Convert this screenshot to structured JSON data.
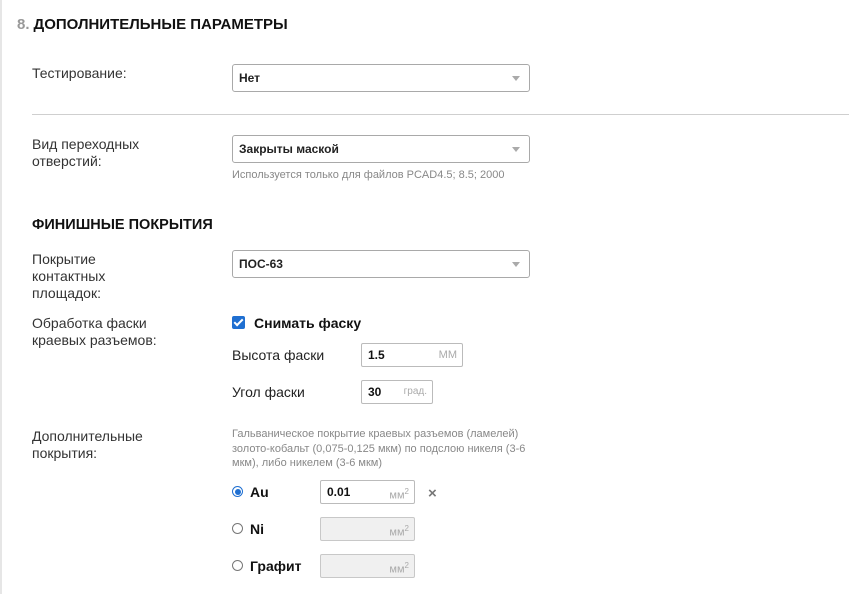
{
  "section": {
    "number": "8.",
    "title": "ДОПОЛНИТЕЛЬНЫЕ ПАРАМЕТРЫ"
  },
  "testing": {
    "label": "Тестирование:",
    "value": "Нет"
  },
  "vias": {
    "label_line1": "Вид переходных",
    "label_line2": "отверстий:",
    "value": "Закрыты маской",
    "hint": "Используется только для файлов PCAD4.5; 8.5; 2000"
  },
  "finish": {
    "title": "ФИНИШНЫЕ ПОКРЫТИЯ",
    "pads": {
      "label_line1": "Покрытие",
      "label_line2": "контактных",
      "label_line3": "площадок:",
      "value": "ПОС-63"
    },
    "bevel": {
      "label_line1": "Обработка фаски",
      "label_line2": "краевых разъемов:",
      "checkbox_label": "Снимать фаску",
      "checked": true,
      "height_label": "Высота фаски",
      "height_value": "1.5",
      "height_unit": "ММ",
      "angle_label": "Угол фаски",
      "angle_value": "30",
      "angle_unit": "град."
    },
    "extra": {
      "label_line1": "Дополнительные",
      "label_line2": "покрытия:",
      "hint_line1": "Гальваническое покрытие краевых разъемов (ламелей)",
      "hint_line2": "золото-кобальт (0,075-0,125 мкм) по подслою никеля (3-6",
      "hint_line3": "мкм), либо никелем (3-6 мкм)",
      "options": [
        {
          "label": "Au",
          "value": "0.01",
          "unit": "мм",
          "unit_sup": "2",
          "selected": true
        },
        {
          "label": "Ni",
          "value": "",
          "unit": "мм",
          "unit_sup": "2",
          "selected": false
        },
        {
          "label": "Графит",
          "value": "",
          "unit": "мм",
          "unit_sup": "2",
          "selected": false
        }
      ],
      "clear_icon": "×"
    }
  }
}
